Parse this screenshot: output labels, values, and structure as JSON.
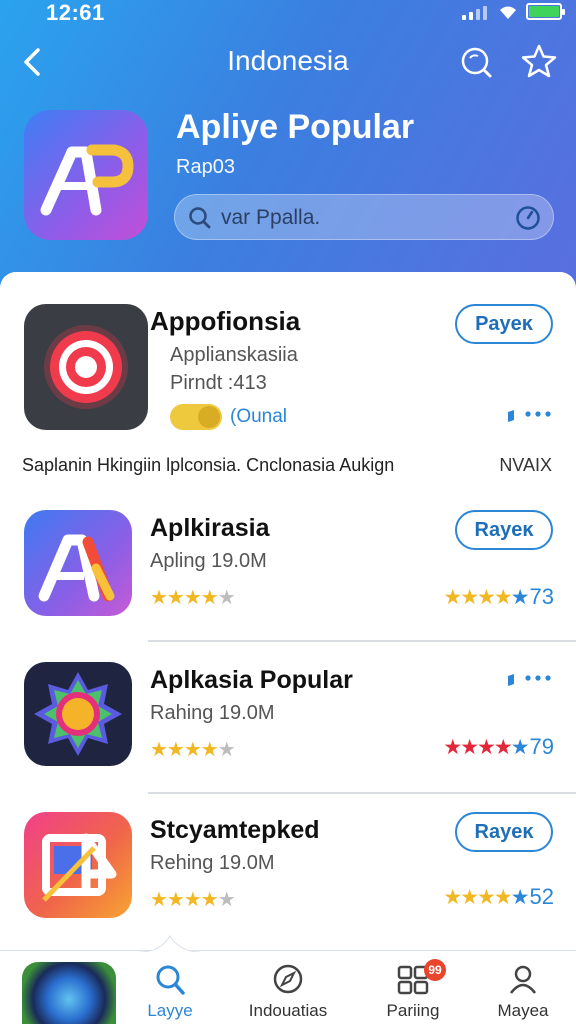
{
  "status": {
    "time": "12:61"
  },
  "header": {
    "title": "Indonesia",
    "app_name": "Apliye Popular",
    "app_sub": "Rap03",
    "search_text": "var Ppalla."
  },
  "featured": {
    "name": "Appofionsia",
    "meta1": "Applianskasiia",
    "meta2": "Pirndt :413",
    "button": "Payeĸ",
    "toggle_label": "(Ounal"
  },
  "description": {
    "text": "Saplanin Hkingiin lplconsia. Cnclonasia Aukign",
    "right": "NVAIX"
  },
  "apps": [
    {
      "name": "Aplkirasia",
      "meta": "Apling 19.0M",
      "stars_left": "★★★★",
      "stars_left_off": "★",
      "stars_right": "★★★★",
      "stars_right_last": "★",
      "rating": "73",
      "button": "Rayeĸ"
    },
    {
      "name": "Aplkasia Popular",
      "meta": "Rahing 19.0M",
      "stars_left": "★★★★",
      "stars_left_off": "★",
      "stars_right": "★★★★",
      "stars_right_last": "★",
      "rating": "79"
    },
    {
      "name": "Stcyamtepked",
      "meta": "Rehing 19.0M",
      "stars_left": "★★★★",
      "stars_left_off": "★",
      "stars_right": "★★★★",
      "stars_right_last": "★",
      "rating": "52",
      "button": "Rayeĸ"
    }
  ],
  "tabs": [
    {
      "label": "Layye"
    },
    {
      "label": "Indouatias"
    },
    {
      "label": "Pariing",
      "badge": "99"
    },
    {
      "label": "Mayea"
    }
  ],
  "colors": {
    "accent": "#2b86d6",
    "header_start": "#2aa3ee",
    "header_end": "#5a6ee0",
    "star_gold": "#f2b824",
    "star_red": "#e4263a",
    "badge": "#e8452c"
  }
}
